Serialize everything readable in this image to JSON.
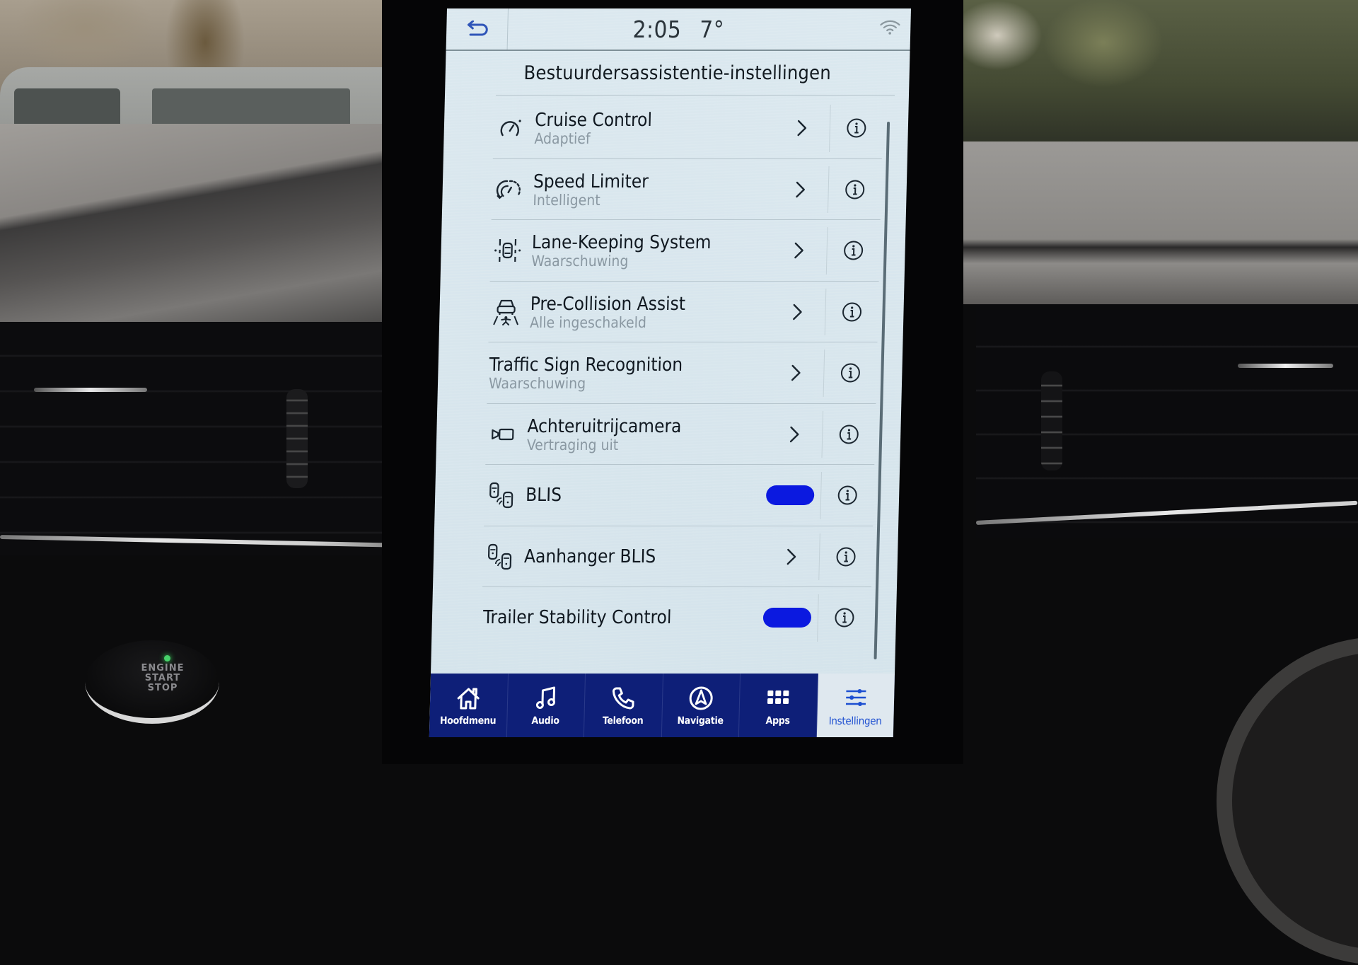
{
  "status_bar": {
    "back_icon": "back-arrow-icon",
    "time": "2:05",
    "temperature": "7°",
    "wifi_icon": "wifi-icon"
  },
  "page": {
    "title": "Bestuurdersassistentie-instellingen"
  },
  "settings": [
    {
      "label": "Cruise Control",
      "sub": "Adaptief",
      "icon": "cruise-control-icon",
      "control": "chevron"
    },
    {
      "label": "Speed Limiter",
      "sub": "Intelligent",
      "icon": "speed-limiter-icon",
      "control": "chevron"
    },
    {
      "label": "Lane-Keeping System",
      "sub": "Waarschuwing",
      "icon": "lane-keeping-icon",
      "control": "chevron"
    },
    {
      "label": "Pre-Collision Assist",
      "sub": "Alle ingeschakeld",
      "icon": "pre-collision-icon",
      "control": "chevron"
    },
    {
      "label": "Traffic Sign Recognition",
      "sub": "Waarschuwing",
      "icon": null,
      "control": "chevron"
    },
    {
      "label": "Achteruitrijcamera",
      "sub": "Vertraging uit",
      "icon": "rear-camera-icon",
      "control": "chevron"
    },
    {
      "label": "BLIS",
      "sub": null,
      "icon": "blis-icon",
      "control": "toggle",
      "on": true
    },
    {
      "label": "Aanhanger BLIS",
      "sub": null,
      "icon": "trailer-blis-icon",
      "control": "chevron"
    },
    {
      "label": "Trailer Stability Control",
      "sub": null,
      "icon": null,
      "control": "toggle",
      "on": true
    }
  ],
  "bottom_nav": [
    {
      "label": "Hoofdmenu",
      "icon": "home-icon",
      "active": false
    },
    {
      "label": "Audio",
      "icon": "music-note-icon",
      "active": false
    },
    {
      "label": "Telefoon",
      "icon": "phone-icon",
      "active": false
    },
    {
      "label": "Navigatie",
      "icon": "navigation-icon",
      "active": false
    },
    {
      "label": "Apps",
      "icon": "apps-grid-icon",
      "active": false
    },
    {
      "label": "Instellingen",
      "icon": "settings-sliders-icon",
      "active": true
    }
  ],
  "car": {
    "engine_button_text": [
      "ENGINE",
      "START",
      "STOP"
    ]
  },
  "colors": {
    "toggle_on": "#0b19e0",
    "nav_bg": "#0e1f78",
    "nav_active_text": "#1d4fd1",
    "screen_bg": "#d7e5ec"
  }
}
